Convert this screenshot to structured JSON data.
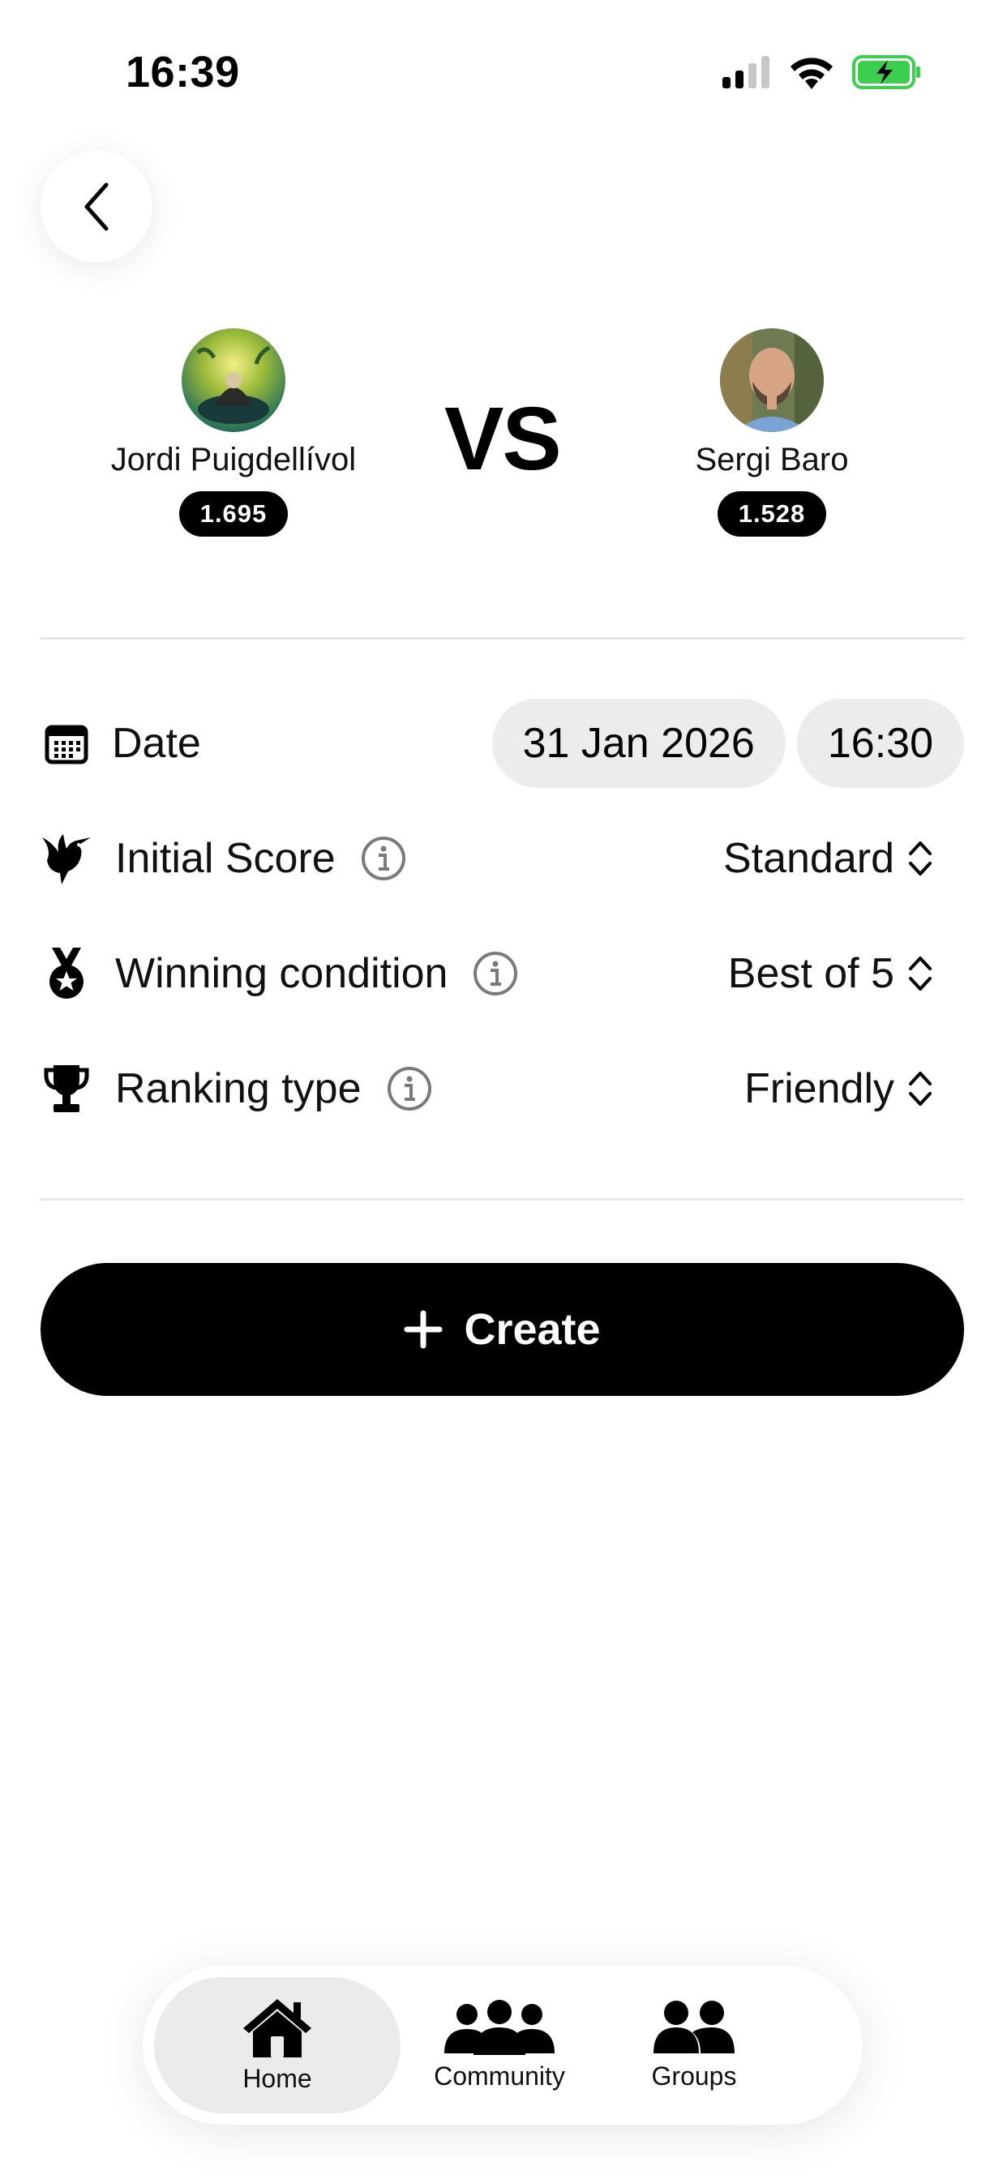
{
  "status_bar": {
    "time": "16:39"
  },
  "match": {
    "player1": {
      "name": "Jordi Puigdellívol",
      "rating": "1.695"
    },
    "vs_label": "VS",
    "player2": {
      "name": "Sergi Baro",
      "rating": "1.528"
    }
  },
  "settings": {
    "date": {
      "label": "Date",
      "date_value": "31 Jan 2026",
      "time_value": "16:30"
    },
    "initial_score": {
      "label": "Initial Score",
      "value": "Standard"
    },
    "winning_condition": {
      "label": "Winning condition",
      "value": "Best of 5"
    },
    "ranking_type": {
      "label": "Ranking type",
      "value": "Friendly"
    }
  },
  "create_button": {
    "label": "Create"
  },
  "tabbar": {
    "tabs": [
      {
        "label": "Home",
        "icon": "home-icon",
        "active": true
      },
      {
        "label": "Community",
        "icon": "community-icon",
        "active": false
      },
      {
        "label": "Groups",
        "icon": "groups-icon",
        "active": false
      }
    ]
  },
  "colors": {
    "battery_green": "#3ccf4e",
    "pill_bg": "#ececec",
    "primary": "#000000"
  }
}
